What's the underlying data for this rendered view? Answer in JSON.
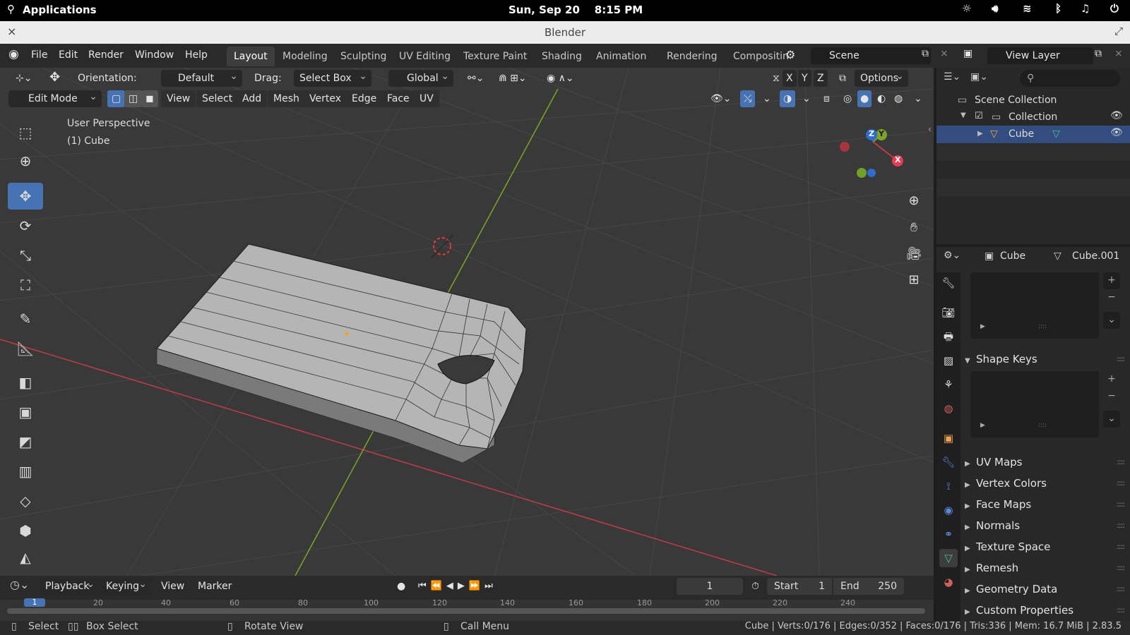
{
  "topbar": {
    "apps": "Applications",
    "clock": "Sun, Sep 20    8:15 PM"
  },
  "window": {
    "title": "Blender"
  },
  "menu": [
    "File",
    "Edit",
    "Render",
    "Window",
    "Help"
  ],
  "workspaces": [
    "Layout",
    "Modeling",
    "Sculpting",
    "UV Editing",
    "Texture Paint",
    "Shading",
    "Animation",
    "Rendering",
    "Compositin"
  ],
  "scene": {
    "name": "Scene",
    "view_layer": "View Layer"
  },
  "header": {
    "orientation_label": "Orientation:",
    "orientation": "Default",
    "drag_label": "Drag:",
    "drag": "Select Box",
    "transform": "Global",
    "options": "Options",
    "x": "X",
    "y": "Y",
    "z": "Z"
  },
  "header2": {
    "mode": "Edit Mode",
    "menus": [
      "View",
      "Select",
      "Add",
      "Mesh",
      "Vertex",
      "Edge",
      "Face",
      "UV"
    ]
  },
  "viewport": {
    "persp": "User Perspective",
    "obj": "(1) Cube"
  },
  "gizmo": {
    "x": "X",
    "y": "Y",
    "z": "Z"
  },
  "outliner": {
    "scene_collection": "Scene Collection",
    "collection": "Collection",
    "cube": "Cube"
  },
  "props": {
    "object": "Cube",
    "data": "Cube.001",
    "sections": [
      "Shape Keys",
      "UV Maps",
      "Vertex Colors",
      "Face Maps",
      "Normals",
      "Texture Space",
      "Remesh",
      "Geometry Data",
      "Custom Properties"
    ]
  },
  "timeline": {
    "menus": [
      "Playback",
      "Keying",
      "View",
      "Marker"
    ],
    "frame": "1",
    "start_label": "Start",
    "start": "1",
    "end_label": "End",
    "end": "250",
    "ticks": [
      "1",
      "20",
      "40",
      "60",
      "80",
      "100",
      "120",
      "140",
      "160",
      "180",
      "200",
      "220",
      "240"
    ]
  },
  "status": {
    "select": "Select",
    "box": "Box Select",
    "rotate": "Rotate View",
    "call": "Call Menu",
    "info": "Cube | Verts:0/176 | Edges:0/352 | Faces:0/176 | Tris:336 | Mem: 16.7 MiB | 2.83.5"
  },
  "colors": {
    "accent": "#4772b3",
    "xaxis": "#c33a4b",
    "yaxis": "#7fa32a"
  }
}
